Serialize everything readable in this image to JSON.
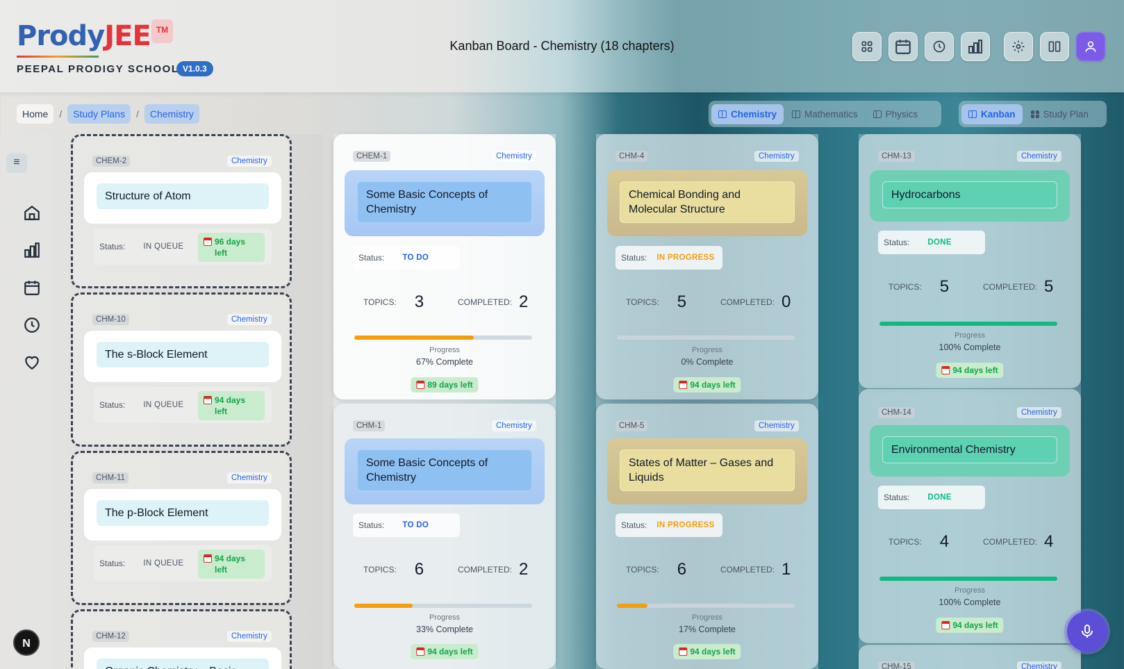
{
  "app": {
    "logo_prody": "Prody",
    "logo_jee": "JEE",
    "trademark": "TM",
    "school": "PEEPAL PRODIGY SCHOOL",
    "version": "V1.0.3"
  },
  "header": {
    "title": "Kanban Board - Chemistry (18 chapters)",
    "icons": [
      "grid-icon",
      "calendar-icon",
      "clock-icon",
      "bar-chart-icon",
      "gear-icon",
      "columns-icon",
      "user-icon"
    ]
  },
  "breadcrumb": [
    "Home",
    "Study Plans",
    "Chemistry"
  ],
  "subject_tabs": [
    {
      "label": "Chemistry",
      "active": true
    },
    {
      "label": "Mathematics",
      "active": false
    },
    {
      "label": "Physics",
      "active": false
    }
  ],
  "view_tabs": [
    {
      "label": "Kanban",
      "active": true
    },
    {
      "label": "Study Plan",
      "active": false
    }
  ],
  "sidebar": {
    "toggle": "≡",
    "icons": [
      "home-icon",
      "bar-chart-icon",
      "calendar-icon",
      "clock-icon",
      "heart-icon"
    ],
    "avatar": "N"
  },
  "labels": {
    "status": "Status:",
    "topics": "TOPICS:",
    "completed": "COMPLETED:",
    "progress": "Progress"
  },
  "queue_cards": [
    {
      "id": "CHEM-2",
      "subject": "Chemistry",
      "title": "Structure of Atom",
      "status": "IN QUEUE",
      "days": "96 days",
      "days2": "left"
    },
    {
      "id": "CHM-10",
      "subject": "Chemistry",
      "title": "The s-Block Element",
      "status": "IN QUEUE",
      "days": "94 days",
      "days2": "left"
    },
    {
      "id": "CHM-11",
      "subject": "Chemistry",
      "title": "The p-Block Element",
      "status": "IN QUEUE",
      "days": "94 days",
      "days2": "left"
    },
    {
      "id": "CHM-12",
      "subject": "Chemistry",
      "title": "Organic Chemistry – Basic"
    }
  ],
  "todo_cards": [
    {
      "id": "CHEM-1",
      "subject": "Chemistry",
      "title": "Some Basic Concepts of Chemistry",
      "status": "TO DO",
      "topics": "3",
      "completed": "2",
      "progress": 0.67,
      "progress_text": "67% Complete",
      "days": "89 days left"
    },
    {
      "id": "CHM-1",
      "subject": "Chemistry",
      "title": "Some Basic Concepts of Chemistry",
      "status": "TO DO",
      "topics": "6",
      "completed": "2",
      "progress": 0.33,
      "progress_text": "33% Complete",
      "days": "94 days left"
    }
  ],
  "inprogress_cards": [
    {
      "id": "CHM-4",
      "subject": "Chemistry",
      "title": "Chemical Bonding and Molecular Structure",
      "status": "IN PROGRESS",
      "topics": "5",
      "completed": "0",
      "progress": 0,
      "progress_text": "0% Complete",
      "days": "94 days left"
    },
    {
      "id": "CHM-5",
      "subject": "Chemistry",
      "title": "States of Matter – Gases and Liquids",
      "status": "IN PROGRESS",
      "topics": "6",
      "completed": "1",
      "progress": 0.17,
      "progress_text": "17% Complete",
      "days": "94 days left"
    }
  ],
  "done_cards": [
    {
      "id": "CHM-13",
      "subject": "Chemistry",
      "title": "Hydrocarbons",
      "status": "DONE",
      "topics": "5",
      "completed": "5",
      "progress": 1,
      "progress_text": "100% Complete",
      "days": "94 days left"
    },
    {
      "id": "CHM-14",
      "subject": "Chemistry",
      "title": "Environmental Chemistry",
      "status": "DONE",
      "topics": "4",
      "completed": "4",
      "progress": 1,
      "progress_text": "100% Complete",
      "days": "94 days left"
    },
    {
      "id": "CHM-15",
      "subject": "Chemistry"
    }
  ],
  "colors": {
    "queue": "#4b5563",
    "todo": "#2563eb",
    "inprogress": "#f59e0b",
    "done": "#10b981",
    "todo_bar": "#f59e0b",
    "inprogress_bar": "#f59e0b",
    "done_bar": "#10b981"
  },
  "mic_icon": "microphone-icon"
}
